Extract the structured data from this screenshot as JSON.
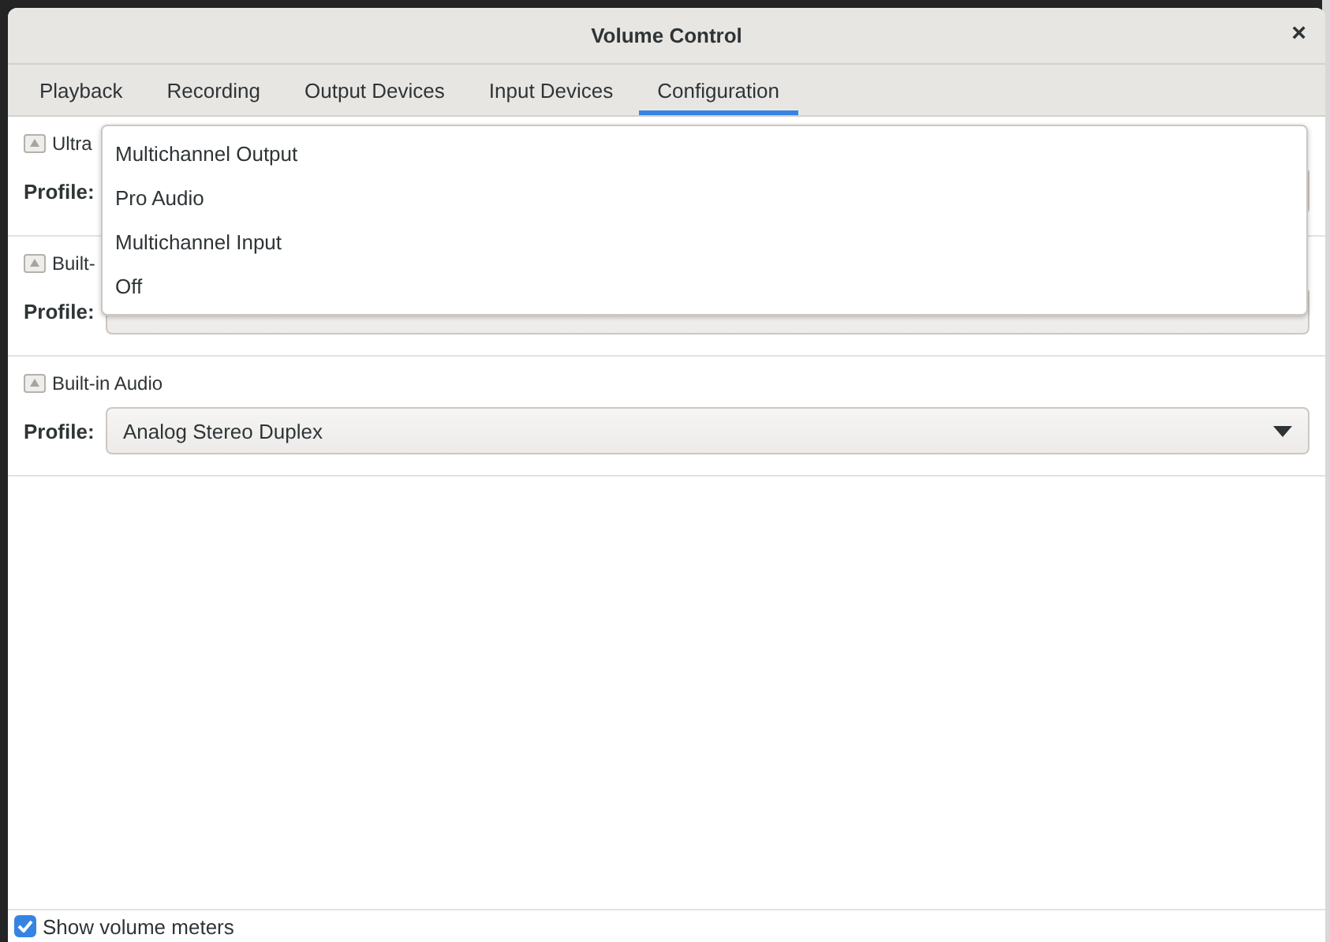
{
  "window": {
    "title": "Volume Control",
    "close": "×"
  },
  "tabs": [
    {
      "label": "Playback",
      "selected": false
    },
    {
      "label": "Recording",
      "selected": false
    },
    {
      "label": "Output Devices",
      "selected": false
    },
    {
      "label": "Input Devices",
      "selected": false
    },
    {
      "label": "Configuration",
      "selected": true
    }
  ],
  "cards": [
    {
      "name": "Ultra",
      "profile_label": "Profile:"
    },
    {
      "name": "Built-",
      "profile_label": "Profile:"
    },
    {
      "name": "Built-in Audio",
      "profile_label": "Profile:",
      "profile": "Analog Stereo Duplex"
    }
  ],
  "dropdown": {
    "items": [
      "Multichannel Output",
      "Pro Audio",
      "Multichannel Input",
      "Off"
    ]
  },
  "footer": {
    "label": "Show volume meters",
    "checked": true
  }
}
